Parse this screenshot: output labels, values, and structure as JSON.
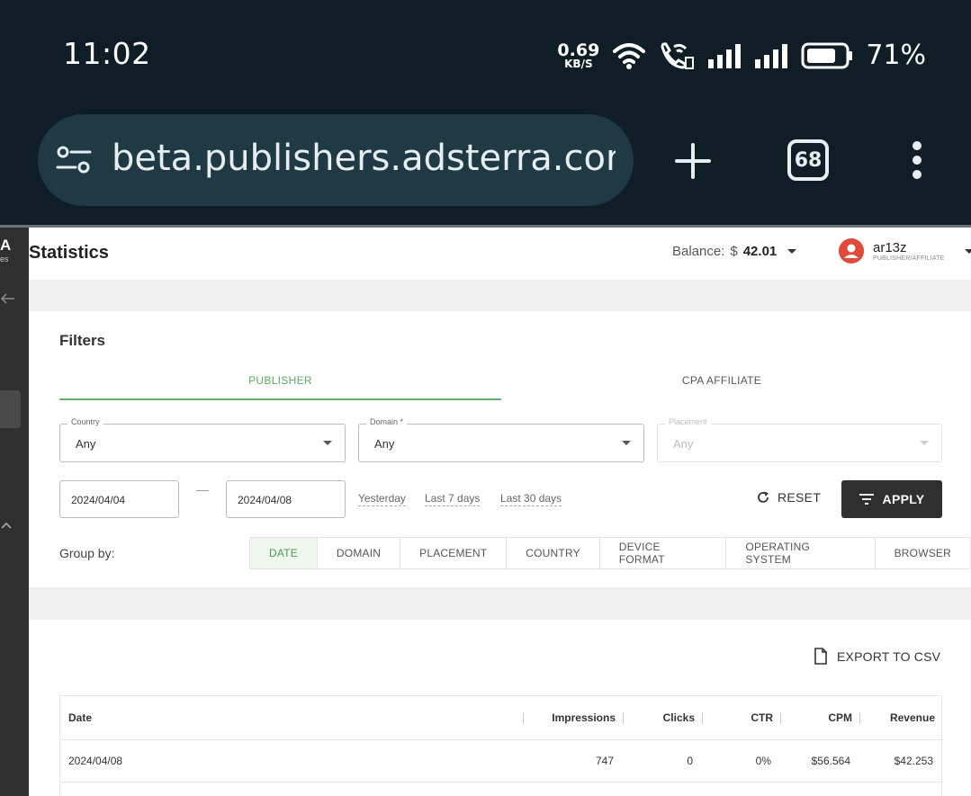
{
  "status_bar": {
    "time": "11:02",
    "net_speed_value": "0.69",
    "net_speed_unit": "KB/S",
    "battery_pct": "71%"
  },
  "browser": {
    "url": "beta.publishers.adsterra.com/s",
    "tab_count": "68"
  },
  "leftnav": {
    "logo_letter": "A",
    "logo_sub": "es"
  },
  "header": {
    "title": "Statistics",
    "balance_label": "Balance:",
    "currency": "$",
    "balance_value": "42.01",
    "username": "ar13z",
    "role": "PUBLISHER/AFFILIATE"
  },
  "filters": {
    "title": "Filters",
    "tabs": [
      "PUBLISHER",
      "CPA AFFILIATE"
    ],
    "country": {
      "label": "Country",
      "value": "Any"
    },
    "domain": {
      "label": "Domain *",
      "value": "Any"
    },
    "placement": {
      "label": "Placement",
      "value": "Any"
    },
    "date_from": "2024/04/04",
    "date_to": "2024/04/08",
    "quick_ranges": [
      "Yesterday",
      "Last 7 days",
      "Last 30 days"
    ],
    "reset_label": "RESET",
    "apply_label": "APPLY",
    "group_by_label": "Group by:",
    "group_by_options": [
      "DATE",
      "DOMAIN",
      "PLACEMENT",
      "COUNTRY",
      "DEVICE FORMAT",
      "OPERATING SYSTEM",
      "BROWSER"
    ],
    "group_by_selected": "DATE"
  },
  "export_label": "EXPORT TO CSV",
  "table": {
    "columns": [
      "Date",
      "Impressions",
      "Clicks",
      "CTR",
      "CPM",
      "Revenue"
    ],
    "rows": [
      [
        "2024/04/08",
        "747",
        "0",
        "0%",
        "$56.564",
        "$42.253"
      ]
    ]
  },
  "colors": {
    "status_bg": "#0f1e26",
    "accent_green": "#5aa85e",
    "apply_bg": "#2f2f2f",
    "avatar": "#e04a3a"
  }
}
